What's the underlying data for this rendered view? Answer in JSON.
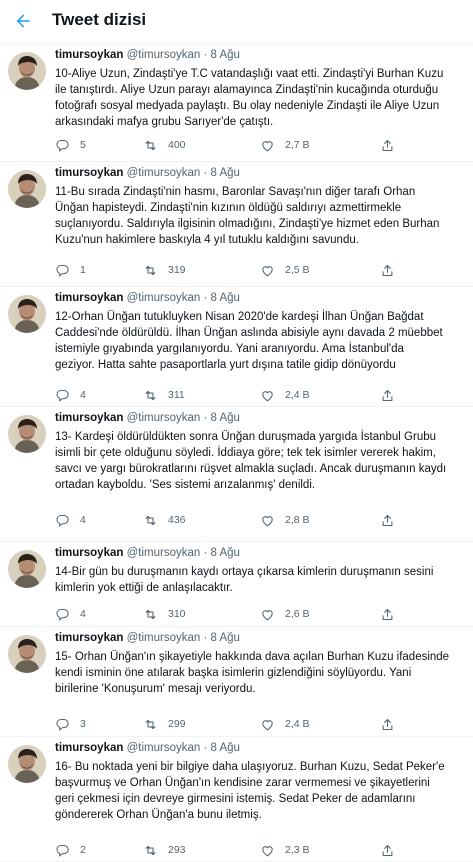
{
  "header": {
    "title": "Tweet dizisi"
  },
  "tweets": [
    {
      "name": "timursoykan",
      "handle": "@timursoykan",
      "dot": "·",
      "date": "8 Ağu",
      "lines": [
        "10-Aliye Uzun, Zindaşti'ye T.C vatandaşlığı vaat etti. Zindaşti'yi Burhan Kuzu",
        "ile tanıştırdı. Aliye Uzun parayı alamayınca Zindaşti'nin kucağında oturduğu",
        "fotoğrafı sosyal medyada paylaştı. Bu olay nedeniyle Zindaşti ile Aliye Uzun",
        "arkasındaki mafya grubu Sarıyer'de çatıştı."
      ],
      "replies": "5",
      "retweets": "400",
      "likes": "2,7 B"
    },
    {
      "name": "timursoykan",
      "handle": "@timursoykan",
      "dot": "·",
      "date": "8 Ağu",
      "lines": [
        "11-Bu sırada Zindaşti'nin hasmı, Baronlar Savaşı'nın diğer tarafı Orhan",
        "Ünğan hapisteydi. Zindaşti'nin kızının öldüğü saldırıyı azmettirmekle",
        "suçlanıyordu. Saldırıyla ilgisinin olmadığını, Zindaşti'ye hizmet eden Burhan",
        "Kuzu'nun hakimlere baskıyla 4 yıl tutuklu kaldığını savundu."
      ],
      "replies": "1",
      "retweets": "319",
      "likes": "2,5 B"
    },
    {
      "name": "timursoykan",
      "handle": "@timursoykan",
      "dot": "·",
      "date": "8 Ağu",
      "lines": [
        "12-Orhan Ünğan tutukluyken Nisan 2020'de kardeşi İlhan Ünğan Bağdat",
        "Caddesi'nde öldürüldü. İlhan Ünğan aslında abisiyle aynı davada 2 müebbet",
        "istemiyle gıyabında yargılanıyordu. Yani aranıyordu. Ama İstanbul'da",
        "geziyor. Hatta sahte pasaportlarla yurt dışına tatile gidip dönüyordu"
      ],
      "replies": "4",
      "retweets": "311",
      "likes": "2,4 B"
    },
    {
      "name": "timursoykan",
      "handle": "@timursoykan",
      "dot": "·",
      "date": "8 Ağu",
      "lines": [
        "13- Kardeşi öldürüldükten sonra Ünğan duruşmada yargıda İstanbul Grubu",
        "isimli bir çete olduğunu söyledi. İddiaya göre; tek tek isimler vererek hakim,",
        "savcı ve yargı bürokratlarını rüşvet almakla suçladı. Ancak duruşmanın kaydı",
        "ortadan kayboldu. 'Ses sistemi arızalanmış' denildi."
      ],
      "replies": "4",
      "retweets": "436",
      "likes": "2,8 B"
    },
    {
      "name": "timursoykan",
      "handle": "@timursoykan",
      "dot": "·",
      "date": "8 Ağu",
      "lines": [
        "14-Bir gün bu duruşmanın kaydı ortaya çıkarsa kimlerin duruşmanın sesini",
        "kimlerin yok ettiği de anlaşılacaktır."
      ],
      "replies": "4",
      "retweets": "310",
      "likes": "2,6 B"
    },
    {
      "name": "timursoykan",
      "handle": "@timursoykan",
      "dot": "·",
      "date": "8 Ağu",
      "lines": [
        "15- Orhan Ünğan'ın şikayetiyle hakkında dava açılan Burhan Kuzu ifadesinde",
        "kendi isminin öne atılarak başka isimlerin gizlendiğini söylüyordu. Yani",
        "birilerine 'Konuşurum' mesajı veriyordu."
      ],
      "replies": "3",
      "retweets": "299",
      "likes": "2,4 B"
    },
    {
      "name": "timursoykan",
      "handle": "@timursoykan",
      "dot": "·",
      "date": "8 Ağu",
      "lines": [
        "16- Bu noktada yeni bir bilgiye daha ulaşıyoruz. Burhan Kuzu, Sedat Peker'e",
        "başvurmuş ve Orhan Ünğan'ın kendisine zarar vermemesi ve şikayetlerini",
        "geri çekmesi için devreye girmesini istemiş. Sedat Peker de adamlarını",
        "göndererek Orhan Ünğan'a bunu iletmiş."
      ],
      "replies": "2",
      "retweets": "293",
      "likes": "2,3 B"
    }
  ],
  "icons": {
    "back": "arrow-left-icon",
    "reply": "reply-icon",
    "retweet": "retweet-icon",
    "like": "heart-icon",
    "share": "share-icon"
  },
  "colors": {
    "accent": "#1d9bf0",
    "secondary_text": "#536471",
    "divider": "#eff3f4"
  }
}
